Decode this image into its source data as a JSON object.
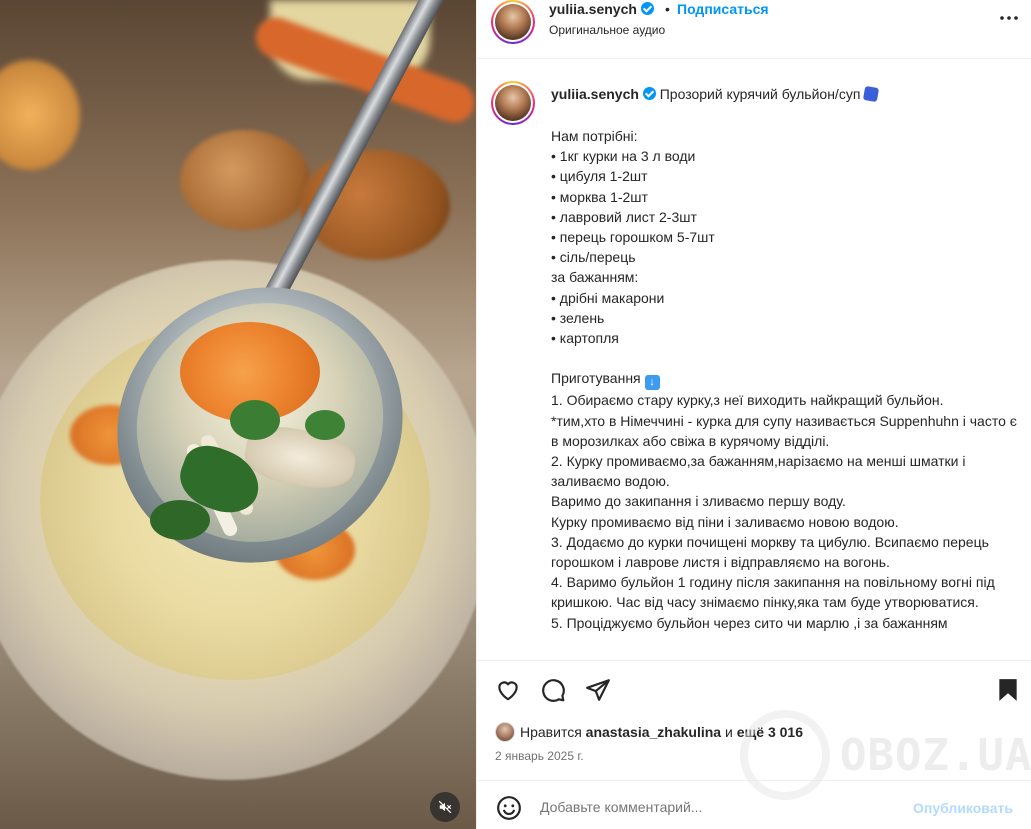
{
  "header": {
    "username": "yuliia.senych",
    "separator": "•",
    "follow_label": "Подписаться",
    "audio_label": "Оригинальное аудио",
    "more_icon": "more-horizontal-icon"
  },
  "caption": {
    "username": "yuliia.senych",
    "title": "Прозорий курячий бульйон/суп",
    "lines": [
      "Нам потрібні:",
      "• 1кг курки на 3 л води",
      "• цибуля 1-2шт",
      "• морква 1-2шт",
      "• лавровий лист 2-3шт",
      "• перець горошком 5-7шт",
      "• сіль/перець",
      "за бажанням:",
      "• дрібні макарони",
      "• зелень",
      "• картопля",
      "",
      "Приготування",
      "1. Обираємо стару курку,з неї виходить найкращий бульйон.",
      "*тим,хто в Німеччині - курка для супу називається Suppenhuhn і часто є в морозилках або свіжа в курячому відділі.",
      "2. Курку промиваємо,за бажанням,нарізаємо на менші шматки і заливаємо водою.",
      "Варимо до закипання і зливаємо першу воду.",
      "Курку промиваємо від піни і заливаємо новою водою.",
      "3. Додаємо до курки почищені моркву та цибулю. Всипаємо перець горошком і лаврове листя і відправляємо на вогонь.",
      "4. Варимо бульйон 1 годину після закипання на повільному вогні під кришкою. Час від часу знімаємо пінку,яка там буде утворюватися.",
      "5. Проціджуємо бульйон через сито чи марлю ,і за бажанням"
    ]
  },
  "actions": {
    "like_icon": "heart-icon",
    "comment_icon": "comment-icon",
    "share_icon": "share-icon",
    "save_icon": "bookmark-icon"
  },
  "likes": {
    "prefix": "Нравится",
    "user": "anastasia_zhakulina",
    "middle": "и",
    "count": "ещё 3 016"
  },
  "date": "2 январь 2025 г.",
  "comment": {
    "placeholder": "Добавьте комментарий...",
    "post_label": "Опубликовать",
    "emoji_icon": "smile-icon"
  },
  "watermark": {
    "text": "OBOZ.UA"
  },
  "colors": {
    "accent": "#0095f6",
    "post_disabled": "#b3dbff",
    "text": "#262626",
    "muted": "#737373"
  }
}
